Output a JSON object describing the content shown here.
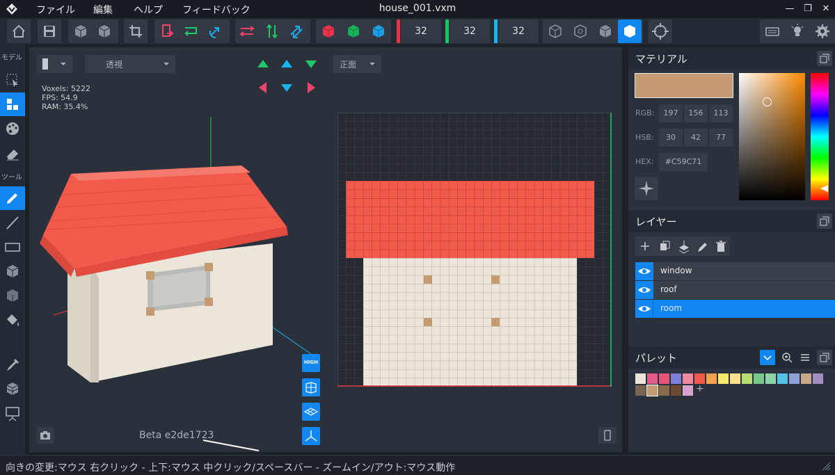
{
  "app": {
    "title": "house_001.vxm"
  },
  "menu": [
    "ファイル",
    "編集",
    "ヘルプ",
    "フィードバック"
  ],
  "toolbar": {
    "size_x": "32",
    "size_y": "32",
    "size_z": "32"
  },
  "sidebar": {
    "model_label": "モデル",
    "tools_label": "ツール"
  },
  "viewport": {
    "view_mode": "透視",
    "camera_direction": "正面",
    "stats": {
      "voxels": "Voxels: 5222",
      "fps": "FPS: 54.9",
      "ram": "RAM: 35.4%"
    },
    "quality_label": "HIGH",
    "beta": "Beta e2de1723"
  },
  "material": {
    "title": "マテリアル",
    "color": "#C59C71",
    "rgb_label": "RGB:",
    "rgb": [
      "197",
      "156",
      "113"
    ],
    "hsb_label": "HSB:",
    "hsb": [
      "30",
      "42",
      "77"
    ],
    "hex_label": "HEX:",
    "hex": "#C59C71"
  },
  "layers": {
    "title": "レイヤー",
    "items": [
      {
        "name": "window",
        "visible": true,
        "selected": false
      },
      {
        "name": "roof",
        "visible": true,
        "selected": false
      },
      {
        "name": "room",
        "visible": true,
        "selected": true
      }
    ]
  },
  "palette": {
    "title": "パレット",
    "add": "+",
    "colors_row1": [
      "#ece6da",
      "#e05a8a",
      "#e45577",
      "#7d7fd6",
      "#f089a0",
      "#f25a4b",
      "#f6a04e",
      "#f5e86a",
      "#f7e08b",
      "#b8dd74",
      "#75c98a",
      "#8ed4a8",
      "#56c2e8",
      "#8ea0d8",
      "#c7a98a",
      "#a28dc1"
    ],
    "colors_row2": [
      "#7a6550",
      "#c59c71",
      "#8b6a4b",
      "#6d4a30",
      "#d9a3d0"
    ]
  },
  "status": {
    "hint": "向きの変更:マウス 右クリック - 上下:マウス 中クリック/スペースバー - ズームイン/アウト:マウス動作"
  }
}
